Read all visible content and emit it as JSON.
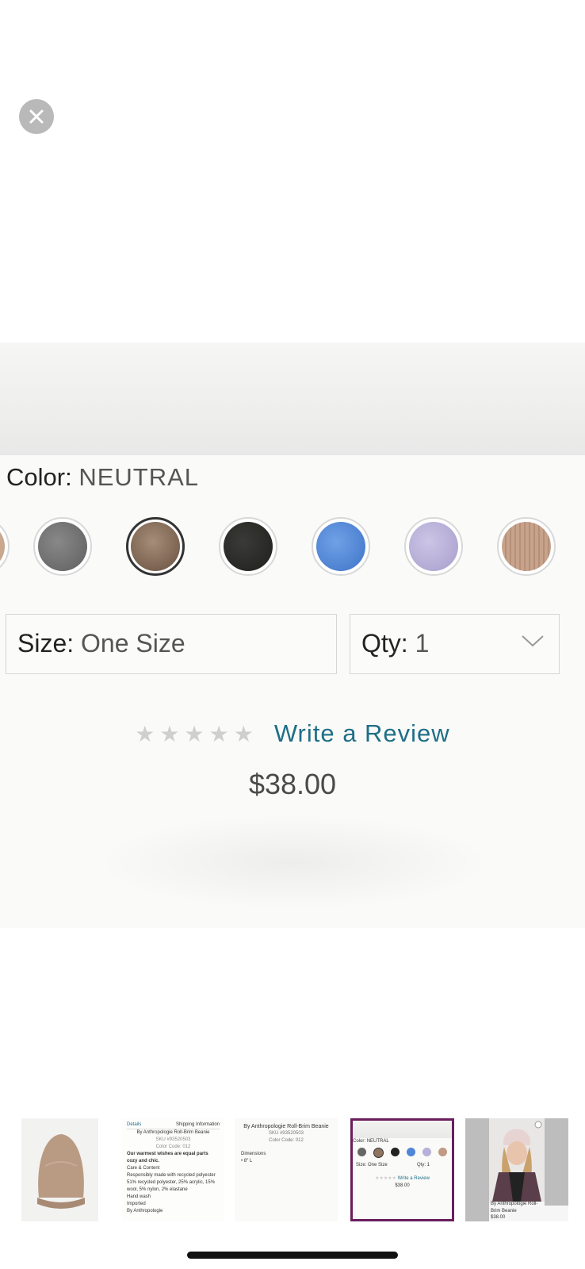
{
  "close_icon": "close-icon",
  "product": {
    "color_label": "Color:",
    "color_value": "NEUTRAL",
    "swatches": [
      {
        "name": "partial-swatch",
        "color": "#c9a88f"
      },
      {
        "name": "grey",
        "color": "#6f6f6f"
      },
      {
        "name": "neutral",
        "color": "#8d7560",
        "selected": true
      },
      {
        "name": "black",
        "color": "#2a2a28"
      },
      {
        "name": "blue",
        "color": "#4f86d6"
      },
      {
        "name": "lavender",
        "color": "#b8b0d6"
      },
      {
        "name": "camel",
        "color": "#c09a83"
      }
    ],
    "size_label": "Size:",
    "size_value": "One Size",
    "qty_label": "Qty:",
    "qty_value": "1",
    "stars": "★★★★★",
    "rating_value": 0,
    "review_link": "Write a Review",
    "price": "$38.00"
  },
  "thumbnails": {
    "t2": {
      "tab_details": "Details",
      "tab_shipping": "Shipping Information",
      "title": "By Anthropologie Roll-Brim Beanie",
      "sku": "SKU #93520503",
      "color_code": "Color Code: 012",
      "blurb": "Our warmest wishes are equal parts cozy and chic.",
      "care_heading": "Care & Content",
      "bullets": [
        "Responsibly made with recycled polyester",
        "51% recycled polyester, 25% acrylic, 15% wool, 5% nylon, 2% elastane",
        "Hand wash",
        "Imported"
      ],
      "brand": "By Anthropologie"
    },
    "t3": {
      "title": "By Anthropologie Roll-Brim Beanie",
      "sku": "SKU #93520503",
      "color_code": "Color Code: 012",
      "dimensions_heading": "Dimensions",
      "dimension": "8\" L"
    },
    "t4": {
      "color_label": "Color:",
      "color_value": "NEUTRAL",
      "size": "Size: One Size",
      "qty": "Qty: 1",
      "review": "Write a Review",
      "price": "$38.00"
    },
    "t5": {
      "name": "By Anthropologie Roll-Brim Beanie",
      "price": "$38.00"
    }
  },
  "colors": {
    "link": "#1e6f87",
    "selected_thumb_border": "#6a1e5e",
    "close_button": "#b9b9b9"
  }
}
